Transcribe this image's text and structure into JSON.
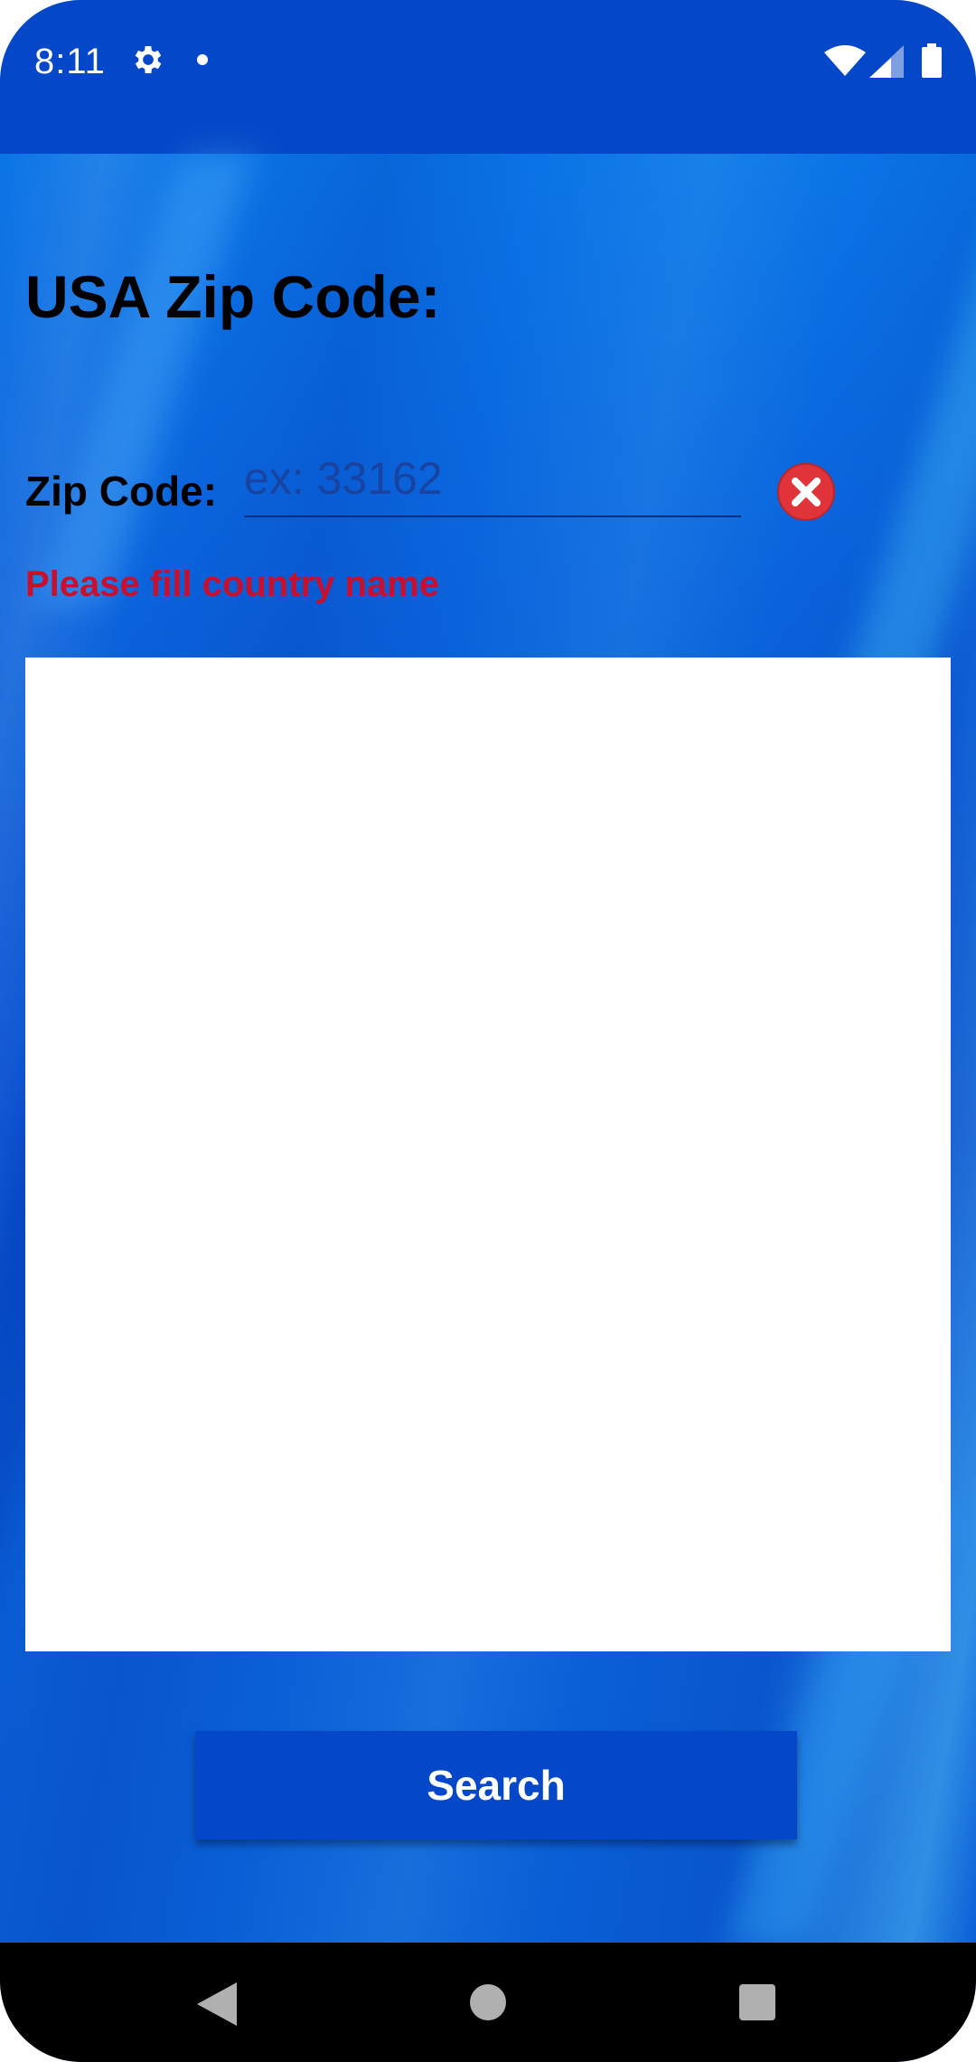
{
  "status_bar": {
    "time": "8:11",
    "icons": [
      "gear-icon",
      "notification-dot-icon",
      "wifi-icon",
      "signal-icon",
      "battery-icon"
    ]
  },
  "page": {
    "title": "USA Zip Code:"
  },
  "form": {
    "zip_label": "Zip Code:",
    "zip_value": "",
    "zip_placeholder": "ex: 33162",
    "clear_icon": "close-circle-icon",
    "error_message": "Please fill country name",
    "search_label": "Search"
  },
  "nav_bar": {
    "icons": [
      "back-icon",
      "home-icon",
      "recents-icon"
    ]
  },
  "colors": {
    "accent": "#0447c8",
    "error": "#c8102e",
    "clear_icon": "#e0343a"
  }
}
